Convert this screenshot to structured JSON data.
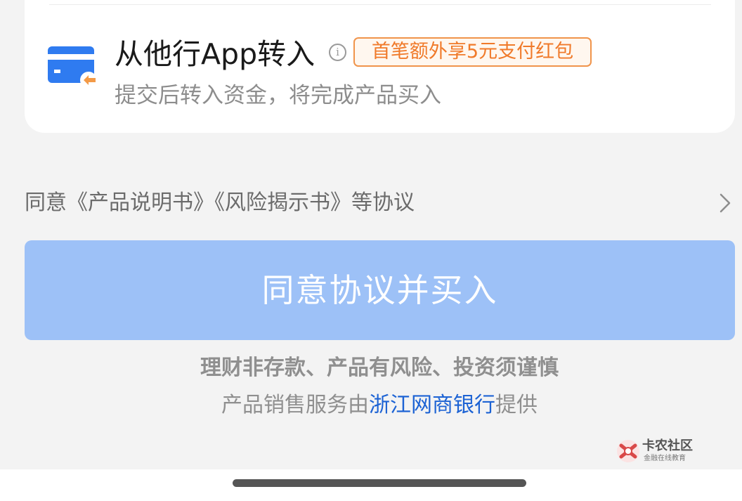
{
  "transfer_option": {
    "title": "从他行App转入",
    "promo_badge": "首笔额外享5元支付红包",
    "subtitle": "提交后转入资金，将完成产品买入",
    "icon": "bank-card-transfer-icon",
    "accent_color": "#2f7bf0"
  },
  "agreement": {
    "text": "同意《产品说明书》《风险揭示书》等协议",
    "icon": "chevron-right-icon"
  },
  "buy_button": {
    "label": "同意协议并买入",
    "color": "#9dc1f7"
  },
  "disclaimer": {
    "risk_text": "理财非存款、产品有风险、投资须谨慎",
    "provider_prefix": "产品销售服务由",
    "provider_bank": "浙江网商银行",
    "provider_suffix": "提供",
    "bank_color": "#1d63d4"
  },
  "watermark": {
    "name": "卡农社区",
    "subtitle": "金融在线教育"
  }
}
